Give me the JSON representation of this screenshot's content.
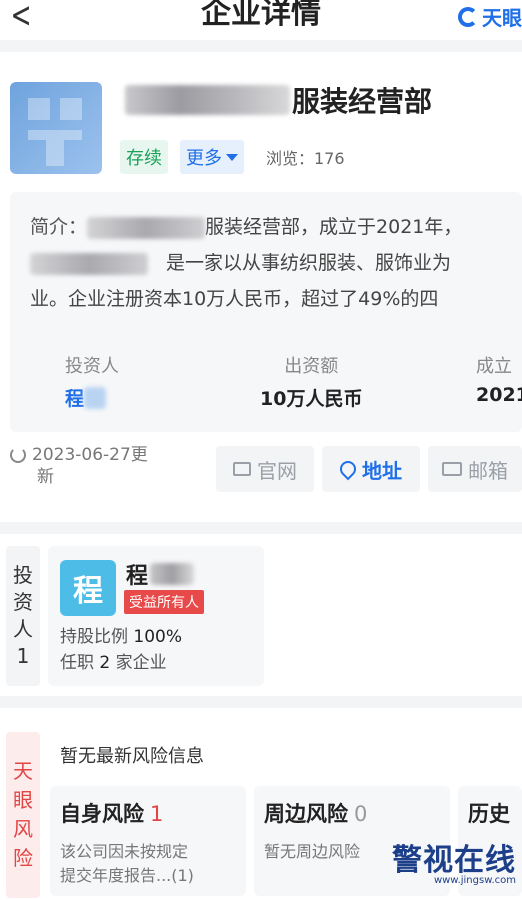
{
  "nav": {
    "title": "企业详情",
    "brand": "天眼"
  },
  "company": {
    "name_suffix": "服装经营部",
    "status": "存续",
    "more": "更多",
    "views": "浏览：176"
  },
  "intro": {
    "label": "简介：",
    "line1_after": "服装经营部，成立于2021年，",
    "line2_after": "是一家以从事纺织服装、服饰业为",
    "line3": "业。企业注册资本10万人民币，超过了49%的四"
  },
  "stats": [
    {
      "key": "投资人",
      "value": "程"
    },
    {
      "key": "出资额",
      "value": "10万人民币"
    },
    {
      "key": "成立",
      "value": "2021"
    }
  ],
  "update": {
    "date": "2023-06-27更",
    "suffix": "新"
  },
  "actions": {
    "website": "官网",
    "address": "地址",
    "email": "邮箱"
  },
  "investor": {
    "side": [
      "投",
      "资",
      "人",
      "1"
    ],
    "avatar": "程",
    "name": "程",
    "badge": "受益所有人",
    "share_label": "持股比例",
    "share": "100%",
    "positions_prefix": "任职",
    "positions_count": "2",
    "positions_suffix": "家企业"
  },
  "risk": {
    "side": [
      "天",
      "眼",
      "风",
      "险"
    ],
    "none_msg": "暂无最新风险信息",
    "cards": [
      {
        "title": "自身风险",
        "count": "1",
        "desc1": "该公司因未按规定",
        "desc2": "提交年度报告...(1)"
      },
      {
        "title": "周边风险",
        "count": "0",
        "desc1": "暂无周边风险",
        "desc2": ""
      },
      {
        "title": "历史",
        "count": "",
        "desc1": "",
        "desc2": ""
      }
    ]
  },
  "watermark": {
    "text": "警视在线",
    "url": "www.jingsw.com"
  },
  "colors": {
    "accent": "#1e6fe8",
    "green": "#1aa15a",
    "red": "#e14545"
  }
}
